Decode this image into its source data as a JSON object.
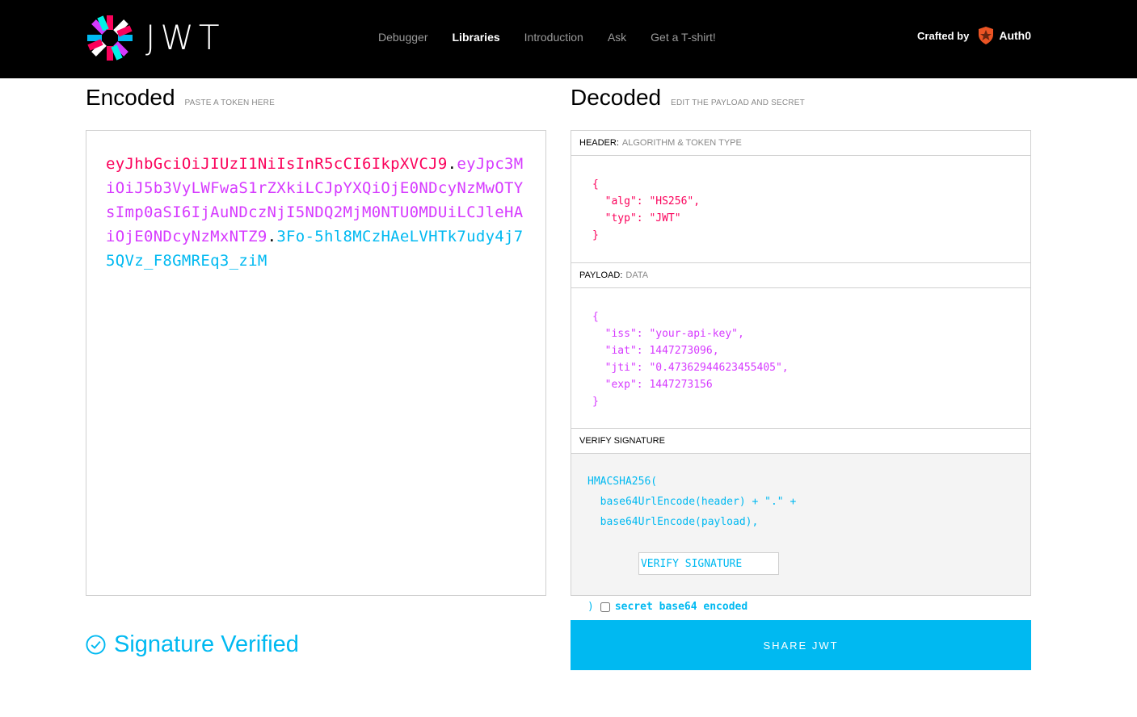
{
  "nav": {
    "logo_text": "JWT",
    "items": [
      {
        "label": "Debugger",
        "active": false
      },
      {
        "label": "Libraries",
        "active": true
      },
      {
        "label": "Introduction",
        "active": false
      },
      {
        "label": "Ask",
        "active": false
      },
      {
        "label": "Get a T-shirt!",
        "active": false
      }
    ],
    "crafted_by": "Crafted by",
    "brand": "Auth0"
  },
  "encoded": {
    "title": "Encoded",
    "hint": "PASTE A TOKEN HERE",
    "token": {
      "header": "eyJhbGciOiJIUzI1NiIsInR5cCI6IkpXVCJ9",
      "payload": "eyJpc3MiOiJ5b3VyLWFwaS1rZXkiLCJpYXQiOjE0NDcyNzMwOTYsImp0aSI6IjAuNDczNjI5NDQ2MjM0NTU0MDUiLCJleHAiOjE0NDcyNzMxNTZ9",
      "signature": "3Fo-5hl8MCzHAeLVHTk7udy4j75QVz_F8GMREq3_ziM",
      "dot": "."
    }
  },
  "decoded": {
    "title": "Decoded",
    "hint": "EDIT THE PAYLOAD AND SECRET",
    "header_section": {
      "label": "HEADER:",
      "sub": "ALGORITHM & TOKEN TYPE",
      "lines": [
        "{",
        "  \"alg\": \"HS256\",",
        "  \"typ\": \"JWT\"",
        "}"
      ]
    },
    "payload_section": {
      "label": "PAYLOAD:",
      "sub": "DATA",
      "lines": [
        "{",
        "  \"iss\": \"your-api-key\",",
        "  \"iat\": 1447273096,",
        "  \"jti\": \"0.47362944623455405\",",
        "  \"exp\": 1447273156",
        "}"
      ]
    },
    "verify_section": {
      "label": "VERIFY SIGNATURE",
      "fn_open": "HMACSHA256(",
      "line1": "  base64UrlEncode(header) + \".\" +",
      "line2": "  base64UrlEncode(payload),",
      "secret_placeholder": "VERIFY SIGNATURE",
      "close": ")",
      "checkbox_label": "secret base64 encoded"
    }
  },
  "status": {
    "text": "Signature Verified"
  },
  "share_button": "SHARE JWT",
  "colors": {
    "header": "#fb015b",
    "payload": "#d63aff",
    "signature": "#00b9f1",
    "topbar": "#000000"
  }
}
